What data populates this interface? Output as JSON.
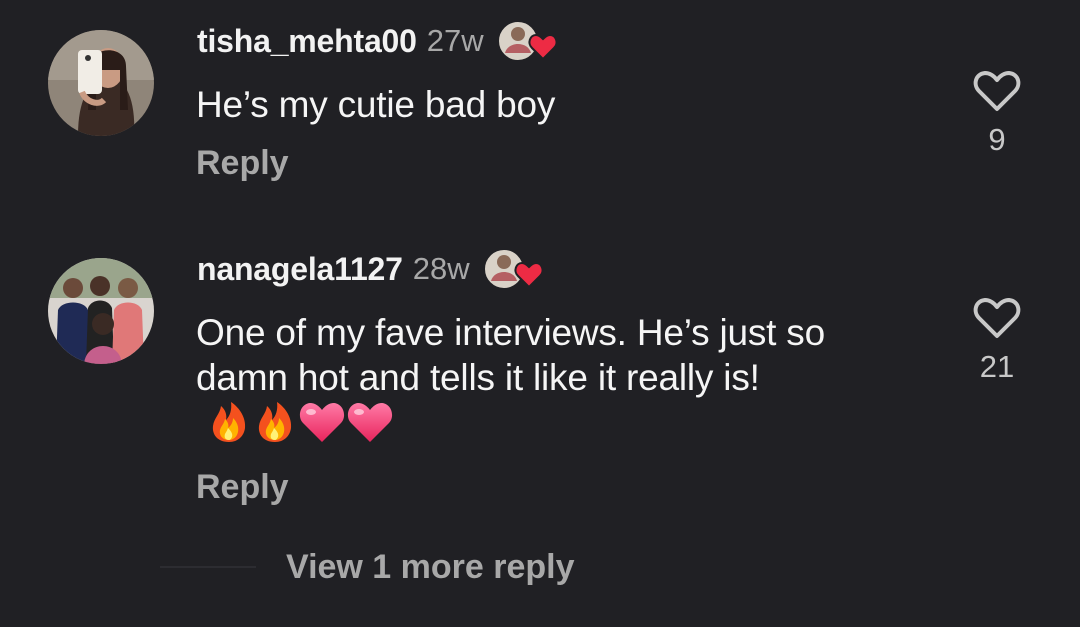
{
  "comments": [
    {
      "username": "tisha_mehta00",
      "time": "27w",
      "text": "He’s my cutie bad boy",
      "emojis": [],
      "reply_label": "Reply",
      "like_count": "9",
      "liked_by_icon": "creator-heart-icon",
      "avatar_icon": "mirror-selfie-avatar"
    },
    {
      "username": "nanagela1127",
      "time": "28w",
      "text": "One of my fave interviews.  He’s just so damn hot and tells it like it really is!",
      "emojis": [
        "fire",
        "fire",
        "pink-heart",
        "pink-heart"
      ],
      "reply_label": "Reply",
      "like_count": "21",
      "liked_by_icon": "creator-heart-icon",
      "avatar_icon": "group-photo-avatar"
    }
  ],
  "view_more": {
    "label": "View 1 more reply"
  },
  "colors": {
    "background": "#202024",
    "primary_text": "#f5f5f5",
    "secondary_text": "#a8a8a8",
    "heart_red": "#ed2b44"
  }
}
